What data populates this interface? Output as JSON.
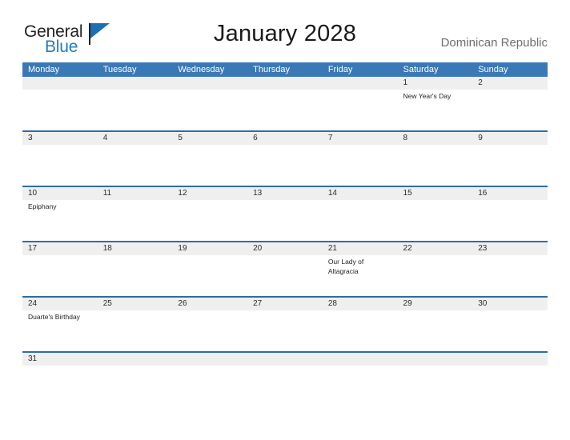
{
  "brand": {
    "name_part1": "General",
    "name_part2": "Blue",
    "flag_icon": "blue-flag-triangle-icon",
    "color_primary": "#1a7dc4",
    "color_dark": "#231f20"
  },
  "header": {
    "title": "January 2028",
    "region": "Dominican Republic"
  },
  "theme": {
    "header_bar": "#3b78b6",
    "row_divider": "#2e6da4",
    "date_strip": "#efefef",
    "page_background": "#ffffff"
  },
  "calendar": {
    "day_headers": [
      "Monday",
      "Tuesday",
      "Wednesday",
      "Thursday",
      "Friday",
      "Saturday",
      "Sunday"
    ],
    "weeks": [
      {
        "dates": [
          "",
          "",
          "",
          "",
          "",
          "1",
          "2"
        ],
        "events": [
          "",
          "",
          "",
          "",
          "",
          "New Year's Day",
          ""
        ]
      },
      {
        "dates": [
          "3",
          "4",
          "5",
          "6",
          "7",
          "8",
          "9"
        ],
        "events": [
          "",
          "",
          "",
          "",
          "",
          "",
          ""
        ]
      },
      {
        "dates": [
          "10",
          "11",
          "12",
          "13",
          "14",
          "15",
          "16"
        ],
        "events": [
          "Epiphany",
          "",
          "",
          "",
          "",
          "",
          ""
        ]
      },
      {
        "dates": [
          "17",
          "18",
          "19",
          "20",
          "21",
          "22",
          "23"
        ],
        "events": [
          "",
          "",
          "",
          "",
          "Our Lady of Altagracia",
          "",
          ""
        ]
      },
      {
        "dates": [
          "24",
          "25",
          "26",
          "27",
          "28",
          "29",
          "30"
        ],
        "events": [
          "Duarte's Birthday",
          "",
          "",
          "",
          "",
          "",
          ""
        ]
      },
      {
        "dates": [
          "31",
          "",
          "",
          "",
          "",
          "",
          ""
        ],
        "events": [
          "",
          "",
          "",
          "",
          "",
          "",
          ""
        ]
      }
    ]
  }
}
